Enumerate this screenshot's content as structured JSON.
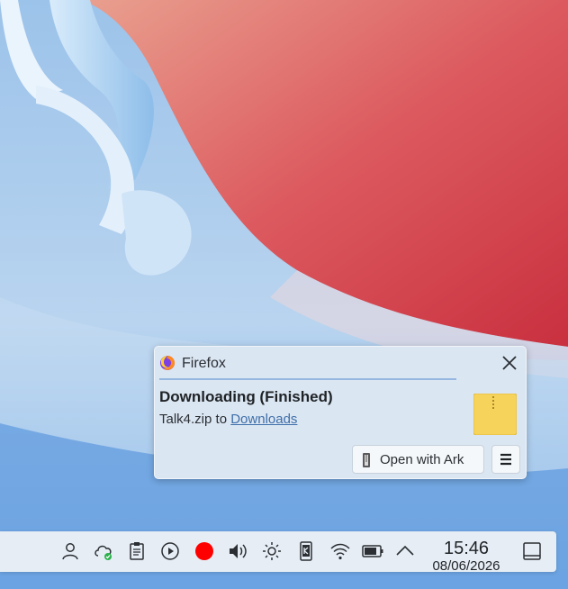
{
  "notification": {
    "app_name": "Firefox",
    "title": "Downloading (Finished)",
    "file_name": "Talk4.zip",
    "to_word": "to",
    "folder_link": "Downloads",
    "action_label": "Open with Ark",
    "close_icon": "close-icon",
    "menu_icon": "hamburger-menu-icon"
  },
  "taskbar": {
    "tray_icons": [
      "user-icon",
      "cloud-sync-icon",
      "clipboard-icon",
      "media-play-icon",
      "record-indicator-icon",
      "volume-icon",
      "brightness-icon",
      "kde-connect-icon",
      "wifi-icon",
      "battery-icon",
      "expand-tray-icon"
    ],
    "clock_time": "15:46",
    "clock_date": "08/06/2026",
    "show_desktop_icon": "show-desktop-icon"
  },
  "colors": {
    "record": "#ff0000",
    "link": "#3e6fa8",
    "panel_bg": "#e6edf5",
    "notification_bg": "#dbe6f3"
  }
}
